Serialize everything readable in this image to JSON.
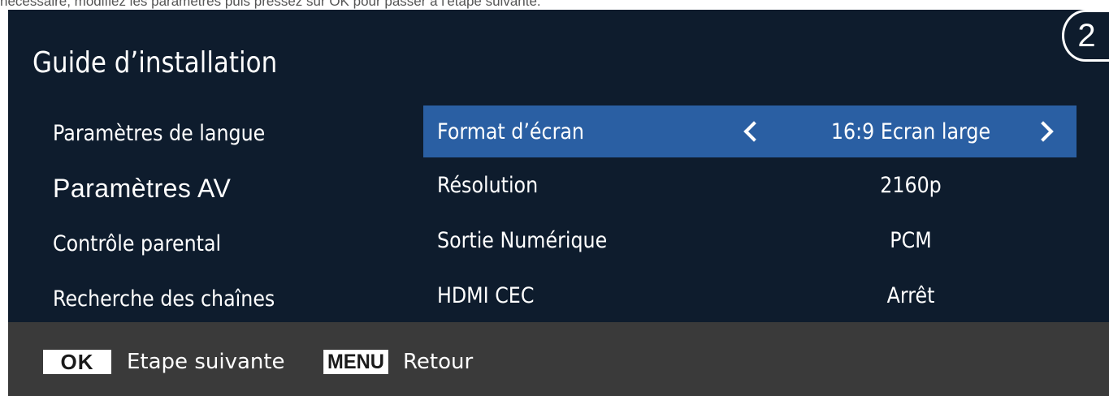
{
  "instruction": "nécessaire, modifiez les paramètres puis pressez sur OK pour passer à l'étape suivante.",
  "step_number": "2",
  "title": "Guide d’installation",
  "left_menu": [
    {
      "label": "Paramètres de langue",
      "active": false
    },
    {
      "label": "Paramètres AV",
      "active": true
    },
    {
      "label": "Contrôle parental",
      "active": false
    },
    {
      "label": "Recherche des chaînes",
      "active": false
    }
  ],
  "settings": [
    {
      "label": "Format d’écran",
      "value": "16:9 Ecran large",
      "selected": true
    },
    {
      "label": "Résolution",
      "value": "2160p",
      "selected": false
    },
    {
      "label": "Sortie Numérique",
      "value": "PCM",
      "selected": false
    },
    {
      "label": "HDMI CEC",
      "value": "Arrêt",
      "selected": false
    }
  ],
  "footer": {
    "ok_key": "OK",
    "ok_label": "Etape suivante",
    "menu_key": "MENU",
    "menu_label": "Retour"
  },
  "colors": {
    "screen_bg": "#0e1c2d",
    "selected_row": "#2a5fa3",
    "footer_bg": "#3a3a3a"
  }
}
